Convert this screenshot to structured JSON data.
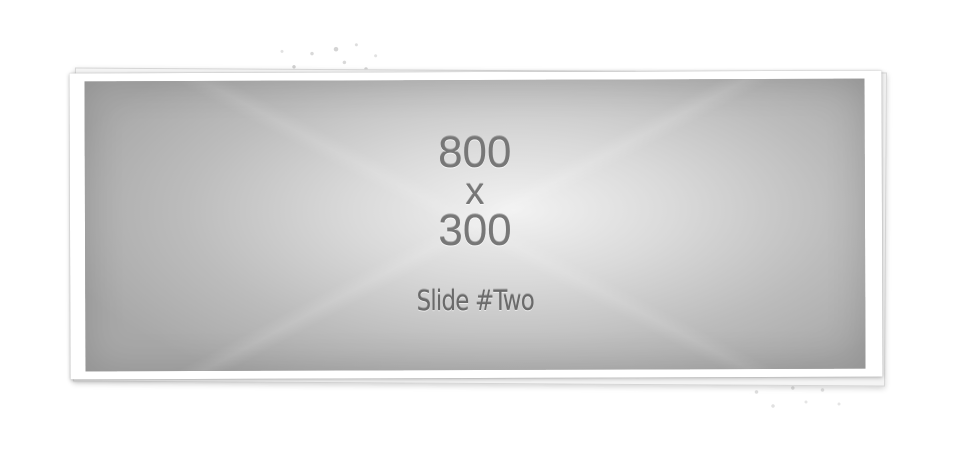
{
  "slider": {
    "current_slide": {
      "dimension_width": "800",
      "dimension_separator": "x",
      "dimension_height": "300",
      "caption": "Slide #Two"
    }
  }
}
